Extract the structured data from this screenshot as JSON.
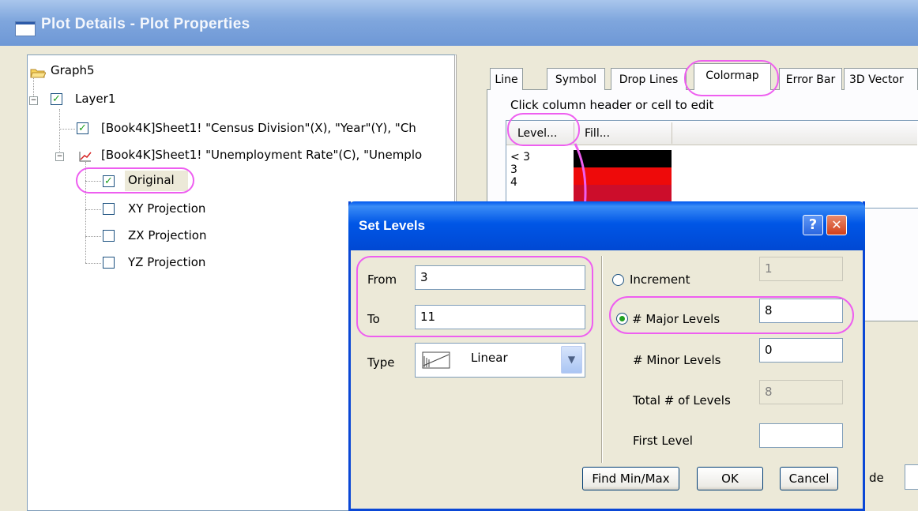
{
  "window": {
    "title": "Plot Details - Plot Properties"
  },
  "tree": {
    "root": "Graph5",
    "layer": "Layer1",
    "plot1": "[Book4K]Sheet1! \"Census Division\"(X), \"Year\"(Y), \"Ch",
    "plot2": "[Book4K]Sheet1! \"Unemployment Rate\"(C), \"Unemplo",
    "items": [
      "Original",
      "XY Projection",
      "ZX Projection",
      "YZ Projection"
    ]
  },
  "tabs": [
    "Line",
    "Symbol",
    "Drop Lines",
    "Colormap",
    "Error Bar",
    "3D Vector"
  ],
  "colormap": {
    "hint": "Click column header or cell to edit",
    "col_level": "Level...",
    "col_fill": "Fill...",
    "levels": [
      "< 3",
      "3",
      "4"
    ],
    "fill_colors": [
      "#000000",
      "#ee0a0a",
      "#cc0d2b"
    ]
  },
  "bottom_fragment": {
    "label": "de"
  },
  "dialog": {
    "title": "Set Levels",
    "help_icon": "?",
    "close_icon": "✕",
    "from_label": "From",
    "from_value": "3",
    "to_label": "To",
    "to_value": "11",
    "type_label": "Type",
    "type_value": "Linear",
    "increment_label": "Increment",
    "increment_value": "1",
    "major_label": "# Major Levels",
    "major_value": "8",
    "minor_label": "# Minor Levels",
    "minor_value": "0",
    "total_label": "Total # of Levels",
    "total_value": "8",
    "first_label": "First Level",
    "first_value": "",
    "find_btn": "Find Min/Max",
    "ok_btn": "OK",
    "cancel_btn": "Cancel"
  },
  "colors": {
    "highlight": "#ee5ef0",
    "xp_blue": "#0048d3"
  }
}
